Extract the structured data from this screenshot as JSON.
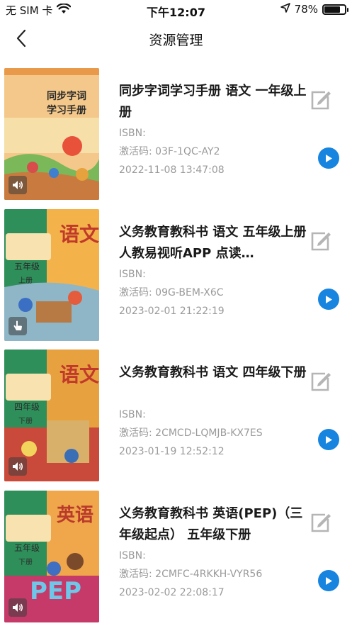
{
  "status": {
    "carrier": "无 SIM 卡",
    "time": "下午12:07",
    "battery_pct": "78%",
    "battery_level": 0.78
  },
  "header": {
    "title": "资源管理"
  },
  "labels": {
    "isbn": "ISBN:"
  },
  "items": [
    {
      "title": "同步字词学习手册 语文 一年级上册",
      "isbn": "ISBN:",
      "code": "激活码: 03F-1QC-AY2",
      "date": "2022-11-08 13:47:08",
      "cover_text": [
        "同步字词",
        "学习手册"
      ],
      "cover_badge": "speaker-icon"
    },
    {
      "title": "义务教育教科书 语文 五年级上册 人教易视听APP 点读…",
      "isbn": "ISBN:",
      "code": "激活码: 09G-BEM-X6C",
      "date": "2023-02-01 21:22:19",
      "cover_text": [
        "语文",
        "五年级",
        "上册"
      ],
      "cover_badge": "hand-pointer-icon"
    },
    {
      "title": "义务教育教科书 语文 四年级下册",
      "isbn": "ISBN:",
      "code": "激活码: 2CMCD-LQMJB-KX7ES",
      "date": "2023-01-19 12:52:12",
      "cover_text": [
        "语文",
        "四年级",
        "下册"
      ],
      "cover_badge": "speaker-icon"
    },
    {
      "title": "义务教育教科书 英语(PEP)（三年级起点） 五年级下册",
      "isbn": "ISBN:",
      "code": "激活码: 2CMFC-4RKKH-VYR56",
      "date": "2023-02-02 22:08:17",
      "cover_text": [
        "英语",
        "五年级",
        "下册",
        "PEP"
      ],
      "cover_badge": "speaker-icon"
    }
  ],
  "colors": {
    "accent": "#1784e0",
    "meta_text": "#9a9a9a",
    "edit_icon": "#b5b5b5"
  }
}
